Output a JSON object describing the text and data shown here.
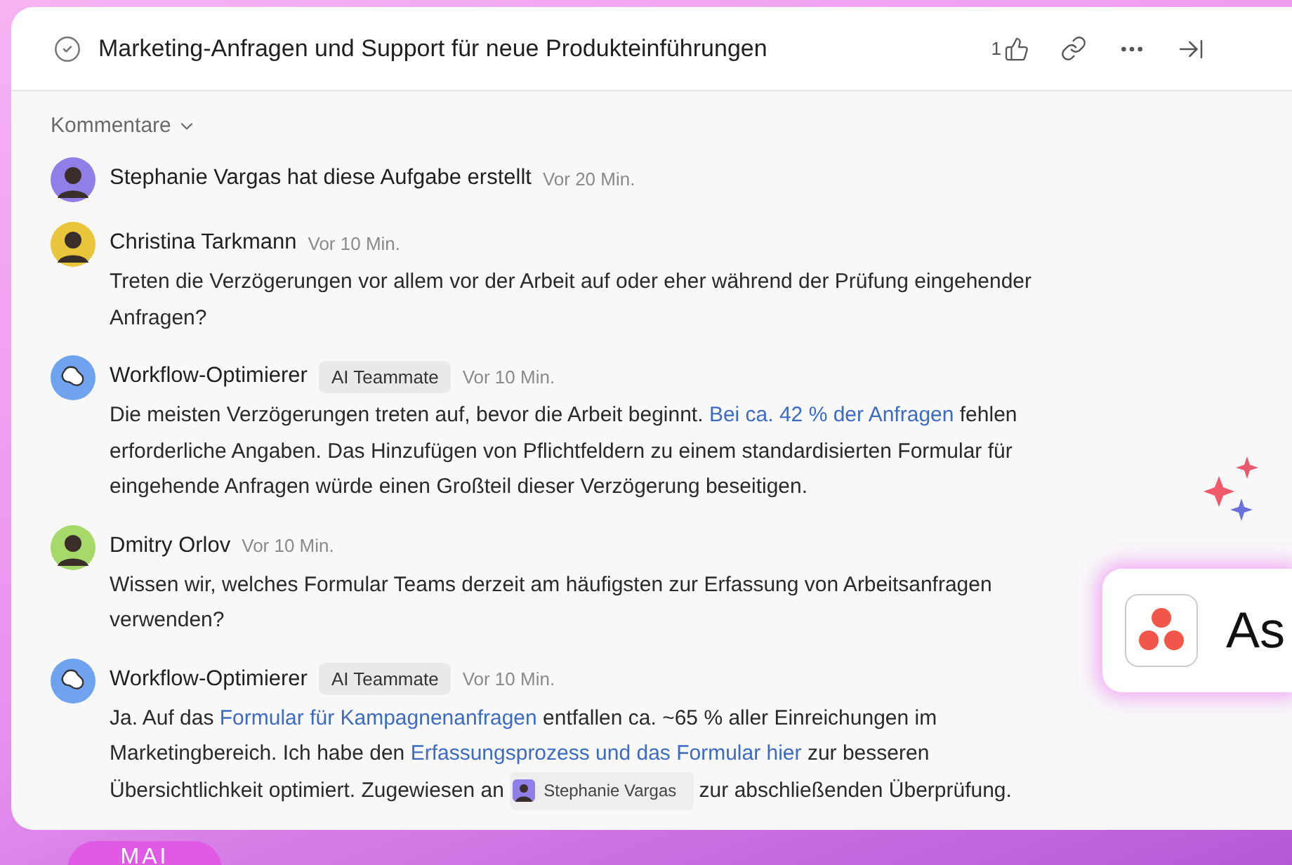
{
  "header": {
    "title": "Marketing-Anfragen und Support für neue Produkteinführungen",
    "like_count": "1"
  },
  "section": {
    "label": "Kommentare"
  },
  "comments": [
    {
      "kind": "activity",
      "is_bot": false,
      "color": "#8f7fe6",
      "text": "Stephanie Vargas hat diese Aufgabe erstellt",
      "time": "Vor 20 Min."
    },
    {
      "kind": "comment",
      "is_bot": false,
      "color": "#e8c53a",
      "author": "Christina Tarkmann",
      "time": "Vor 10 Min.",
      "body": [
        {
          "kind": "plain",
          "text": "Treten die Verzögerungen vor allem vor der Arbeit auf oder eher während der Prüfung eingehender Anfragen?"
        }
      ]
    },
    {
      "kind": "comment",
      "is_bot": true,
      "color": "#6fa3ef",
      "author": "Workflow-Optimierer",
      "badge": "AI Teammate",
      "time": "Vor 10 Min.",
      "body": [
        {
          "kind": "plain",
          "text": "Die meisten Verzögerungen treten auf, bevor die Arbeit beginnt. "
        },
        {
          "kind": "link",
          "text": "Bei ca. 42 % der Anfragen"
        },
        {
          "kind": "plain",
          "text": " fehlen erforderliche Angaben. Das Hinzufügen von Pflichtfeldern zu einem standardisierten Formular für eingehende Anfragen würde einen Großteil dieser Verzögerung beseitigen."
        }
      ]
    },
    {
      "kind": "comment",
      "is_bot": false,
      "color": "#a6d86a",
      "author": "Dmitry Orlov",
      "time": "Vor 10 Min.",
      "body": [
        {
          "kind": "plain",
          "text": "Wissen wir, welches Formular Teams derzeit am häufigsten zur Erfassung von Arbeitsanfragen verwenden?"
        }
      ]
    },
    {
      "kind": "comment",
      "is_bot": true,
      "color": "#6fa3ef",
      "author": "Workflow-Optimierer",
      "badge": "AI Teammate",
      "time": "Vor 10 Min.",
      "body": [
        {
          "kind": "plain",
          "text": "Ja. Auf das "
        },
        {
          "kind": "link",
          "text": "Formular für Kampagnenanfragen"
        },
        {
          "kind": "plain",
          "text": " entfallen ca. ~65 % aller Einreichungen im Marketingbereich. Ich habe den "
        },
        {
          "kind": "link",
          "text": "Erfassungsprozess und das Formular hier"
        },
        {
          "kind": "plain",
          "text": " zur besseren Übersichtlichkeit optimiert. Zugewiesen an "
        },
        {
          "kind": "mention",
          "text": "Stephanie Vargas"
        },
        {
          "kind": "plain",
          "text": "  zur abschließenden Überprüfung."
        }
      ]
    }
  ],
  "floating_card": {
    "text": "As"
  },
  "bottom_button": {
    "label": "MAI"
  }
}
